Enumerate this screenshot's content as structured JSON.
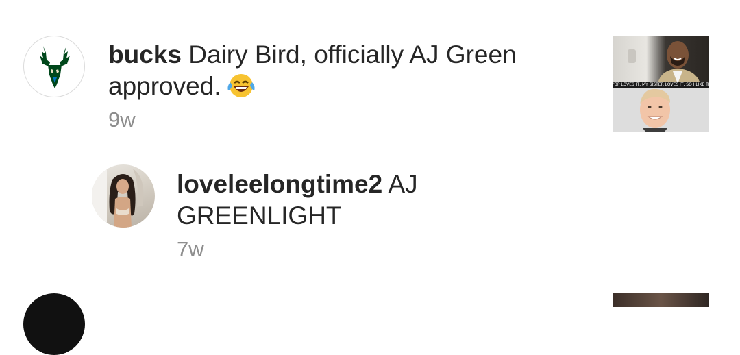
{
  "comments": [
    {
      "username": "bucks",
      "text": "Dairy Bird, officially AJ Green approved.",
      "emoji": "😂",
      "emoji_name": "face-with-tears-of-joy",
      "age": "9w",
      "avatar_icon": "bucks-logo-icon",
      "brand_color": "#00471B",
      "thumbnail_caption": "\"BP LOVES IT, MY SISTER LOVES IT, SO I LIKE THAT.\""
    },
    {
      "username": "loveleelongtime2",
      "text": "AJ GREENLIGHT",
      "age": "7w",
      "avatar_icon": "user-avatar"
    }
  ]
}
